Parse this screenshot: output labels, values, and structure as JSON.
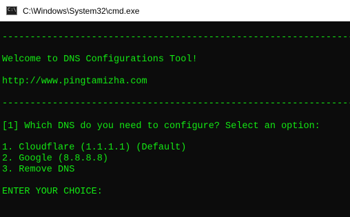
{
  "window": {
    "title": "C:\\Windows\\System32\\cmd.exe",
    "icon": "cmd-console-icon",
    "text_color": "#13e813",
    "background": "#0c0c0c"
  },
  "console": {
    "separator_top": "----------------------------------------------------------------",
    "welcome": "Welcome to DNS Configurations Tool!",
    "url": "http://www.pingtamizha.com",
    "separator_bottom": "----------------------------------------------------------------",
    "question": "[1] Which DNS do you need to configure? Select an option:",
    "options": [
      "1. Cloudflare (1.1.1.1) (Default)",
      "2. Google (8.8.8.8)",
      "3. Remove DNS"
    ],
    "prompt": "ENTER YOUR CHOICE:"
  }
}
